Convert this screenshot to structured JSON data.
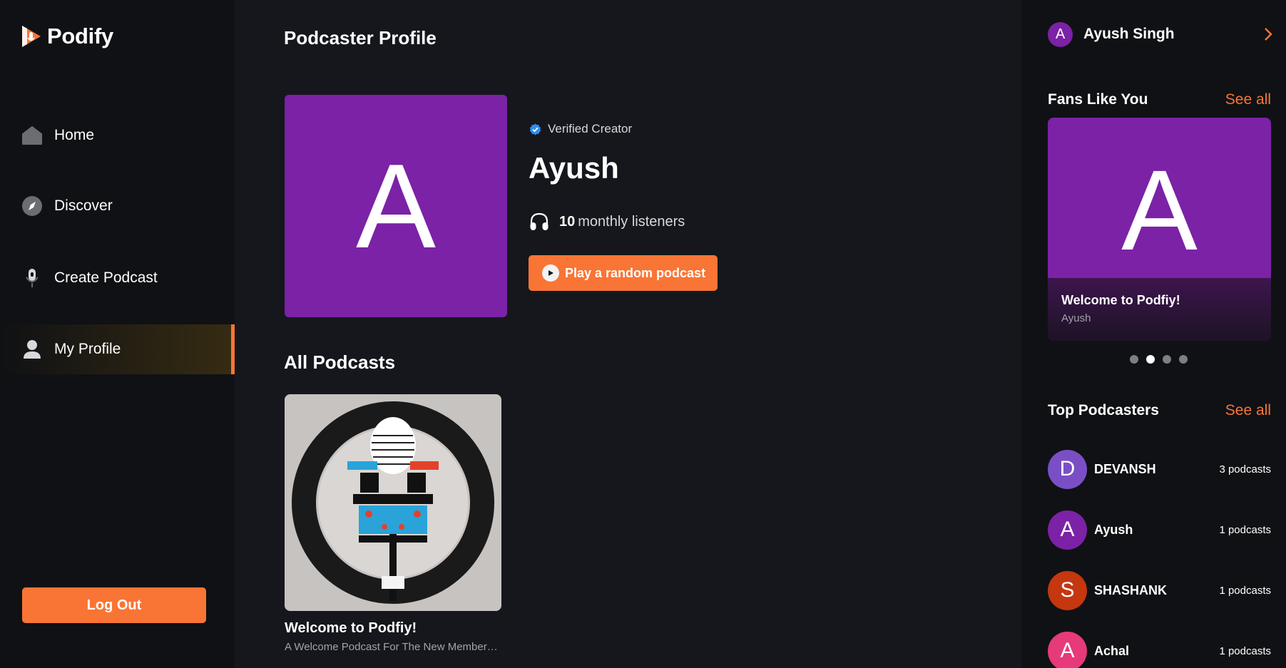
{
  "app": {
    "name": "Podify"
  },
  "sidebar": {
    "items": [
      {
        "label": "Home",
        "icon": "home-icon"
      },
      {
        "label": "Discover",
        "icon": "compass-icon"
      },
      {
        "label": "Create Podcast",
        "icon": "microphone-icon"
      },
      {
        "label": "My Profile",
        "icon": "user-icon",
        "active": true
      }
    ],
    "logout_label": "Log Out"
  },
  "main": {
    "title": "Podcaster Profile",
    "profile": {
      "initial": "A",
      "verified_label": "Verified Creator",
      "name": "Ayush",
      "listener_count": "10",
      "listener_suffix": "monthly listeners",
      "play_random_label": "Play a random podcast"
    },
    "all_podcasts_title": "All Podcasts",
    "podcasts": [
      {
        "title": "Welcome to Podfiy!",
        "description": "A Welcome Podcast For The New Members Of The Podify Platform"
      }
    ]
  },
  "right": {
    "user": {
      "initial": "A",
      "name": "Ayush Singh"
    },
    "fans_heading": "Fans Like You",
    "fans_see_all": "See all",
    "fan_card": {
      "initial": "A",
      "title": "Welcome to Podfiy!",
      "author": "Ayush"
    },
    "carousel": {
      "count": 4,
      "active_index": 1
    },
    "top_heading": "Top Podcasters",
    "top_see_all": "See all",
    "podcasters": [
      {
        "initial": "D",
        "name": "DEVANSH",
        "count": "3 podcasts",
        "color": "#7a4fc6"
      },
      {
        "initial": "A",
        "name": "Ayush",
        "count": "1 podcasts",
        "color": "#7b22a6"
      },
      {
        "initial": "S",
        "name": "SHASHANK",
        "count": "1 podcasts",
        "color": "#c4370f"
      },
      {
        "initial": "A",
        "name": "Achal",
        "count": "1 podcasts",
        "color": "#e63a7a"
      }
    ]
  },
  "colors": {
    "accent": "#f97535",
    "brand_purple": "#7b22a6",
    "background": "#15171c",
    "sidebar": "#101114"
  }
}
